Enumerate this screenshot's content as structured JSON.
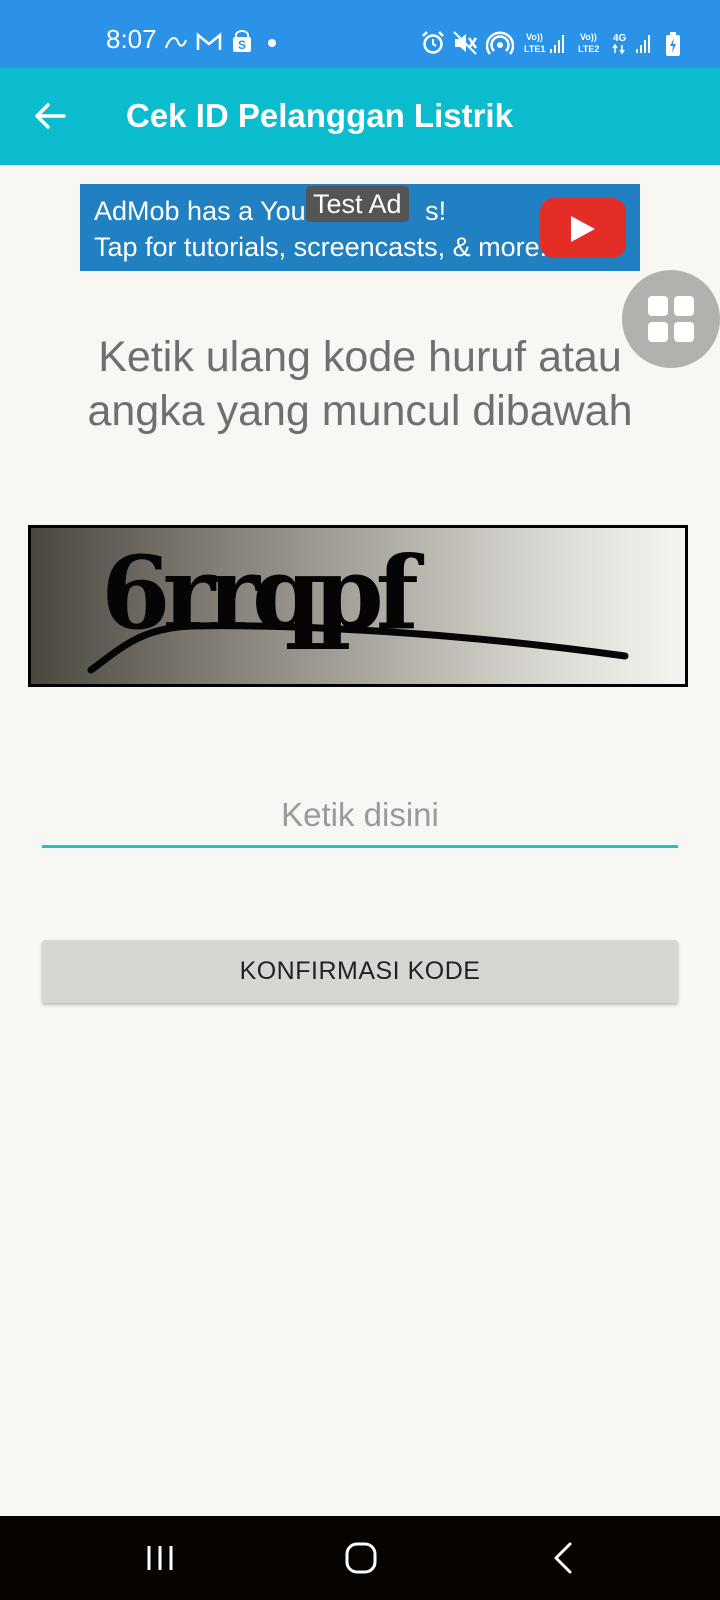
{
  "status_bar": {
    "time": "8:07",
    "icons": [
      "link-icon",
      "gmail-icon",
      "shopping-bag-icon",
      "dot-icon",
      "alarm-icon",
      "mute-icon",
      "hotspot-icon",
      "volte-lte1-signal-icon",
      "volte-lte2-signal-icon",
      "4g-icon",
      "battery-charging-icon"
    ],
    "lte1_label": "LTE1",
    "lte2_label": "LTE2",
    "network_label": "4G"
  },
  "app_bar": {
    "title": "Cek ID Pelanggan Listrik",
    "back_icon": "arrow-left-icon"
  },
  "ad": {
    "line1": "AdMob has a YouT",
    "line1_end": "s!",
    "line2": "Tap for tutorials, screencasts, & more.",
    "badge": "Test Ad"
  },
  "main": {
    "instruction": "Ketik ulang kode huruf atau angka yang muncul dibawah",
    "captcha_text": "6rrqpf",
    "input_placeholder": "Ketik disini",
    "input_value": "",
    "confirm_label": "KONFIRMASI KODE"
  },
  "fab_icon": "grid-icon",
  "nav_bar": {
    "icons": [
      "recent-apps-icon",
      "home-icon",
      "back-icon"
    ]
  },
  "colors": {
    "status_bar": "#2a93e8",
    "app_bar": "#0bbcce",
    "ad_background": "#2180c2",
    "input_underline": "#1bc4c0",
    "button": "#d8d6d2"
  }
}
